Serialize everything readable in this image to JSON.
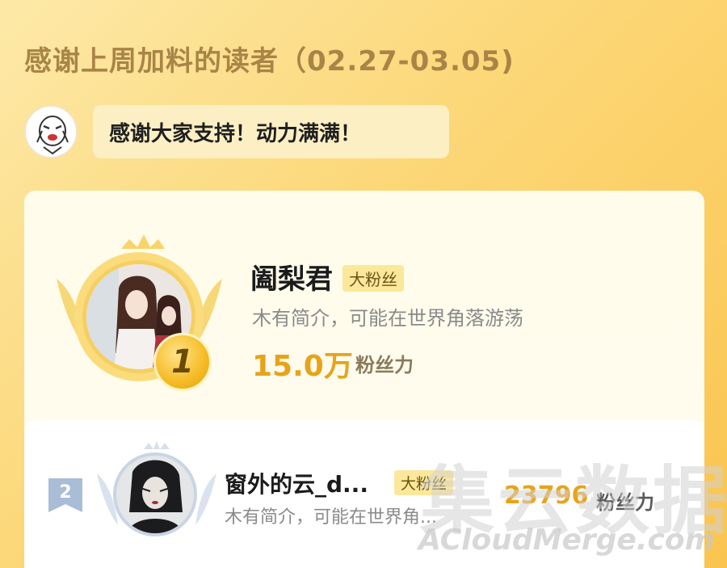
{
  "header": {
    "title": "感谢上周加料的读者（02.27-03.05)"
  },
  "message": {
    "avatar_icon": "meme-face-icon",
    "text": "感谢大家支持！动力满满！"
  },
  "ranking": [
    {
      "rank": "1",
      "name": "阖梨君",
      "badge": "大粉丝",
      "description": "木有简介，可能在世界角落游荡",
      "score": "15.0万",
      "score_unit": "粉丝力"
    },
    {
      "rank": "2",
      "name": "窗外的云_d...",
      "badge": "大粉丝",
      "description": "木有简介，可能在世界角...",
      "score": "23796",
      "score_unit": "粉丝力"
    }
  ],
  "watermark": {
    "cn": "集云数据",
    "en": "ACloudMerge.com"
  },
  "colors": {
    "accent": "#e8a319",
    "badge_bg": "#fce89a",
    "title": "#a98447"
  }
}
